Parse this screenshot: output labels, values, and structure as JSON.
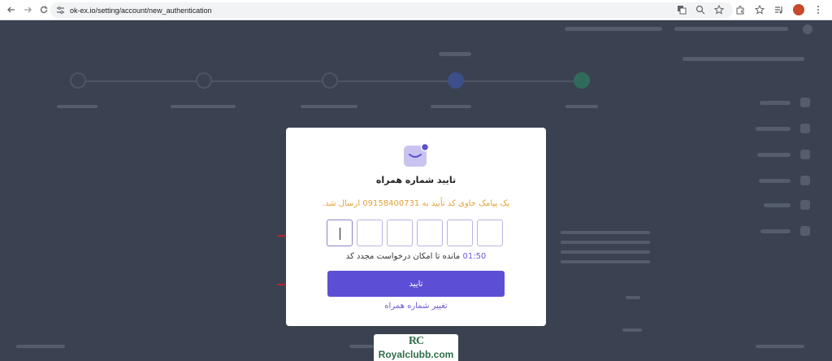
{
  "browser": {
    "url": "ok-ex.io/setting/account/new_authentication",
    "icons": [
      "back-icon",
      "forward-icon",
      "reload-icon",
      "site-info-icon",
      "translate-icon",
      "zoom-icon",
      "bookmark-star-icon",
      "extensions-icon",
      "reading-list-icon",
      "media-icon",
      "profile-avatar"
    ]
  },
  "modal": {
    "title": "تایید شماره همراه",
    "sms_message": "یک پیامک حاوی کد تأیید به 09158400731 ارسال شد.",
    "code_inputs": [
      "",
      "",
      "",
      "",
      "",
      ""
    ],
    "timer": "01:50",
    "timer_suffix": "مانده تا امکان درخواست مجدد کد",
    "confirm_label": "تایید",
    "change_number_label": "تغییر شماره همراه"
  },
  "colors": {
    "overlay": "#3a4150",
    "primary": "#5b4fd6",
    "warning_text": "#e5a03a",
    "arrow": "#d62020"
  },
  "watermark": {
    "logo": "RC",
    "text": "Royalclubb.com"
  }
}
